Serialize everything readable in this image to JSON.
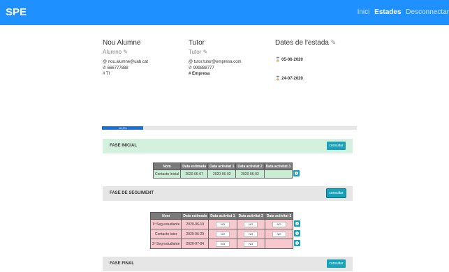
{
  "navbar": {
    "brand": "SPE",
    "links": [
      {
        "label": "Inici",
        "active": false
      },
      {
        "label": "Estades",
        "active": true
      },
      {
        "label": "Desconnectar",
        "active": false
      }
    ]
  },
  "student": {
    "heading": "Nou Alumne",
    "role": "Alumno",
    "email": "nou.alumne@uab.cat",
    "phone": "666777888",
    "group": "TI"
  },
  "tutor": {
    "heading": "Tutor",
    "role": "Tutor",
    "email": "tutor.tutor@empresa.com",
    "phone": "999888777",
    "company": "Empresa"
  },
  "dates": {
    "heading": "Dates de l'estada",
    "start": "05-06-2020",
    "end": "24-07-2020"
  },
  "progress": {
    "label": "16,3%",
    "value": 16.3
  },
  "phases": [
    {
      "title": "FASE INICIAL",
      "button": "consultar",
      "headers": [
        "Nom",
        "Data estimada",
        "Data activitat 1",
        "Data activitat 2",
        "Data activitat 3"
      ],
      "rows": [
        {
          "nom": "Contacto Inicial",
          "estimada": "2020-06-07",
          "a1": "2020-06-02",
          "a2": "2020-06-02",
          "a3": ""
        }
      ]
    },
    {
      "title": "FASE DE SEGUIMENT",
      "button": "consultar",
      "headers": [
        "Nom",
        "Data estimada",
        "Data activitat 1",
        "Data activitat 2",
        "Data activitat 3"
      ],
      "rows": [
        {
          "nom": "1º Seg estudiante",
          "estimada": "2020-06-19",
          "a1": "NO",
          "a2": "NO",
          "a3": "NO"
        },
        {
          "nom": "Contacto tutor",
          "estimada": "2020-06-29",
          "a1": "NO",
          "a2": "NO",
          "a3": "NO"
        },
        {
          "nom": "2º Seg estudiante",
          "estimada": "2020-07-04",
          "a1": "NO",
          "a2": "NO",
          "a3": ""
        }
      ]
    },
    {
      "title": "FASE FINAL",
      "button": "consultar"
    }
  ],
  "colors": {
    "navbar": "#1e90ff",
    "phase_done": "#d4f1df",
    "phase_pending": "#e6e6e6",
    "button": "#17a2b8",
    "row_done": "#c8ecd4",
    "row_pending": "#f8c8cf"
  },
  "icons": {
    "edit": "pencil-square-icon",
    "email": "at-icon",
    "phone": "phone-icon",
    "group": "hash-icon",
    "start": "hourglass-start-icon",
    "end": "hourglass-end-icon",
    "info": "info-circle-icon"
  }
}
